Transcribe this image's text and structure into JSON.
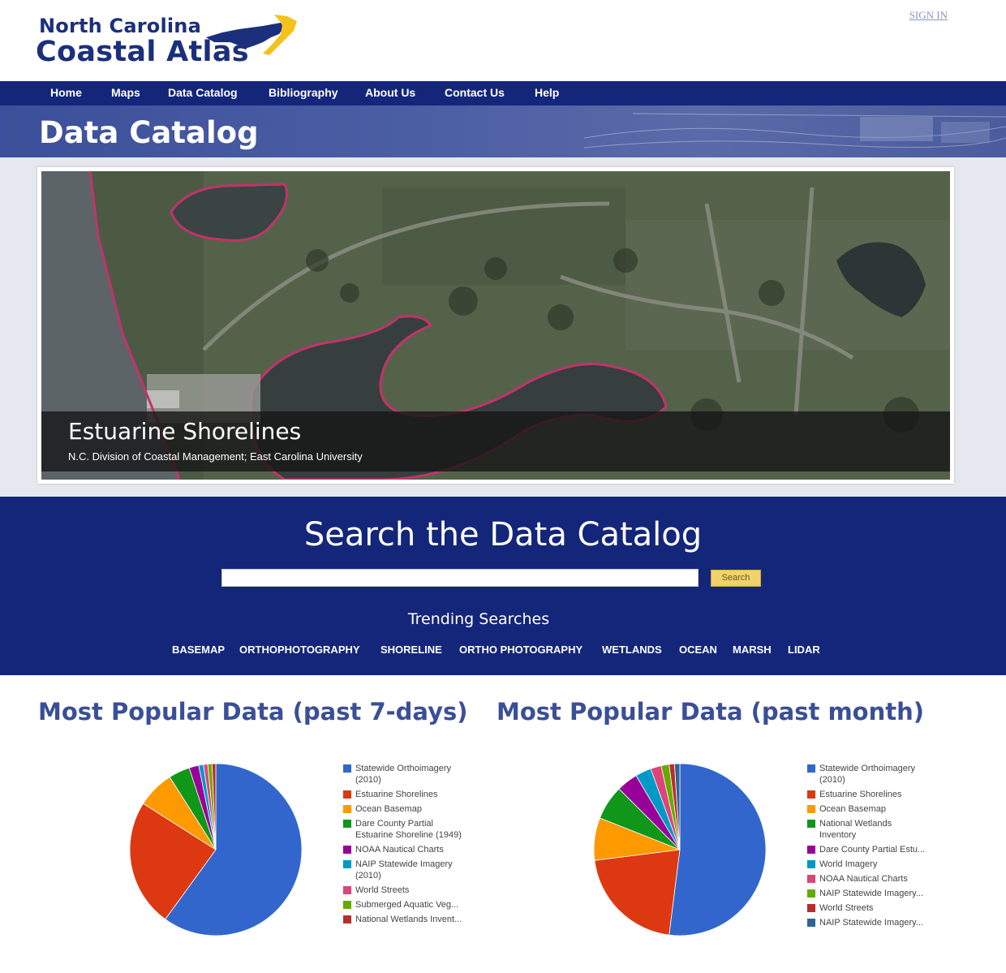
{
  "header": {
    "logo_line1": "North Carolina",
    "logo_line2": "Coastal Atlas",
    "sign_in": "SIGN IN"
  },
  "nav": {
    "items": [
      "Home",
      "Maps",
      "Data Catalog",
      "Bibliography",
      "About Us",
      "Contact Us",
      "Help"
    ]
  },
  "page_title": "Data Catalog",
  "hero": {
    "title": "Estuarine Shorelines",
    "subtitle": "N.C. Division of Coastal Management; East Carolina University"
  },
  "search": {
    "heading": "Search the Data Catalog",
    "input_value": "",
    "button_label": "Search",
    "trending_heading": "Trending Searches",
    "trending": [
      "BASEMAP",
      "ORTHOPHOTOGRAPHY",
      "SHORELINE",
      "ORTHO PHOTOGRAPHY",
      "WETLANDS",
      "OCEAN",
      "MARSH",
      "LIDAR"
    ]
  },
  "popular_week": {
    "heading": "Most Popular Data (past 7-days)"
  },
  "popular_month": {
    "heading": "Most Popular Data (past month)"
  },
  "colors": {
    "navy": "#14267a",
    "accent_yellow": "#f1d36a",
    "title_blue": "#3b4f97"
  },
  "chart_data": [
    {
      "type": "pie",
      "title": "Most Popular Data (past 7-days)",
      "legend_position": "right",
      "series": [
        {
          "name": "Statewide Orthoimagery (2010)",
          "value": 60.0,
          "color": "#3366cc"
        },
        {
          "name": "Estuarine Shorelines",
          "value": 24.0,
          "color": "#dc3912"
        },
        {
          "name": "Ocean Basemap",
          "value": 7.0,
          "color": "#ff9900"
        },
        {
          "name": "Dare County Partial Estuarine Shoreline (1949)",
          "value": 4.0,
          "color": "#109618"
        },
        {
          "name": "NOAA Nautical Charts",
          "value": 1.8,
          "color": "#990099"
        },
        {
          "name": "NAIP Statewide Imagery (2010)",
          "value": 0.9,
          "color": "#0099c6"
        },
        {
          "name": "World Streets",
          "value": 0.8,
          "color": "#dd4477"
        },
        {
          "name": "Submerged Aquatic Veg...",
          "value": 0.8,
          "color": "#66aa00"
        },
        {
          "name": "National Wetlands Invent...",
          "value": 0.7,
          "color": "#b82e2e"
        }
      ]
    },
    {
      "type": "pie",
      "title": "Most Popular Data (past month)",
      "legend_position": "right",
      "series": [
        {
          "name": "Statewide Orthoimagery (2010)",
          "value": 52.0,
          "color": "#3366cc"
        },
        {
          "name": "Estuarine Shorelines",
          "value": 21.0,
          "color": "#dc3912"
        },
        {
          "name": "Ocean Basemap",
          "value": 8.0,
          "color": "#ff9900"
        },
        {
          "name": "National Wetlands Inventory",
          "value": 6.5,
          "color": "#109618"
        },
        {
          "name": "Dare County Partial Estu...",
          "value": 4.0,
          "color": "#990099"
        },
        {
          "name": "World Imagery",
          "value": 3.0,
          "color": "#0099c6"
        },
        {
          "name": "NOAA Nautical Charts",
          "value": 2.0,
          "color": "#dd4477"
        },
        {
          "name": "NAIP Statewide Imagery...",
          "value": 1.5,
          "color": "#66aa00"
        },
        {
          "name": "World Streets",
          "value": 1.0,
          "color": "#b82e2e"
        },
        {
          "name": "NAIP Statewide Imagery...",
          "value": 1.0,
          "color": "#316395"
        }
      ]
    }
  ]
}
